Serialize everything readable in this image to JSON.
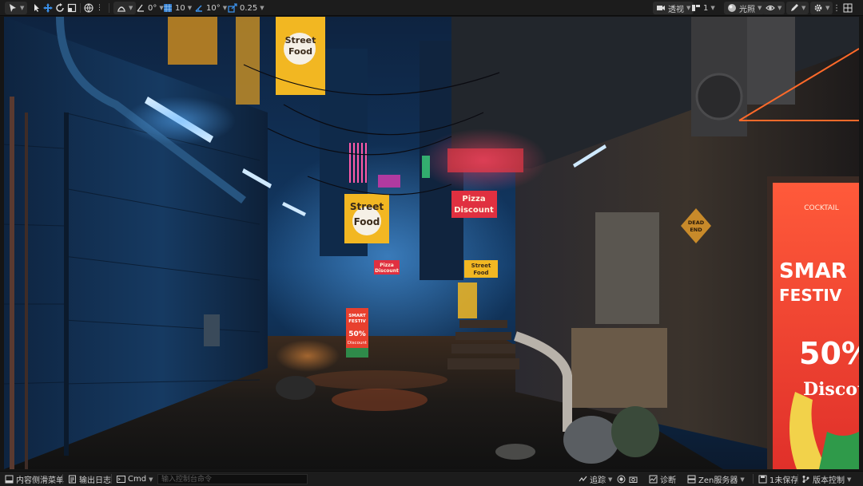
{
  "toolbar": {
    "rotate_snap": "0°",
    "grid_snap": "10",
    "angle_snap": "10°",
    "scale_snap": "0.25",
    "view_mode": "透视",
    "layers": "1",
    "lighting_mode": "光照",
    "icons": [
      "select-mode-icon",
      "cursor-icon",
      "translate-icon",
      "rotate-icon",
      "scale-icon",
      "world-icon",
      "snap-surface-icon",
      "camera-icon",
      "eye-icon",
      "settings-icon",
      "more-icon",
      "layout-icon"
    ]
  },
  "scene": {
    "signs": {
      "street_food_top": "Street\nFood",
      "street_food_top_l1": "Street",
      "street_food_top_l2": "Food",
      "street_food_mid_l1": "Street",
      "street_food_mid_l2": "Food",
      "pizza_discount_l1": "Pizza",
      "pizza_discount_l2": "Discount",
      "pizza_small_l1": "Pizza",
      "pizza_small_l2": "Discount",
      "street_food_small_l1": "Street",
      "street_food_small_l2": "Food",
      "dead_end_l1": "DEAD",
      "dead_end_l2": "END",
      "smart_small_l1": "SMART",
      "smart_small_l2": "FESTIV",
      "smart_small_l3": "50%",
      "smart_small_l4": "Discount",
      "billboard_top": "COCKTAIL",
      "billboard_l1": "SMAR",
      "billboard_l2": "FESTIV",
      "billboard_l3": "50%",
      "billboard_l4": "Discou"
    }
  },
  "statusbar": {
    "content_drawer": "内容侧滑菜单",
    "output_log": "输出日志",
    "cmd": "Cmd",
    "cmd_placeholder": "输入控制台命令",
    "trace": "追踪",
    "diagnostics": "诊断",
    "zen_server": "Zen服务器",
    "unsaved": "1未保存",
    "source_control": "版本控制"
  }
}
